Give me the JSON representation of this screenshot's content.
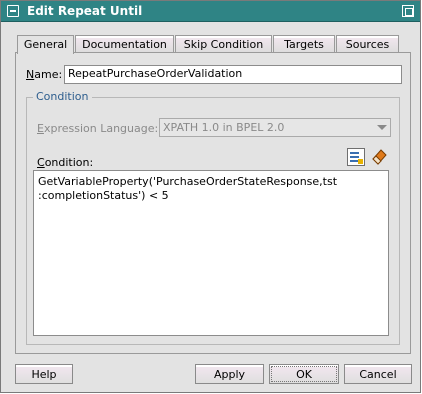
{
  "window": {
    "title": "Edit Repeat Until"
  },
  "tabs": [
    {
      "label": "General",
      "active": true
    },
    {
      "label": "Documentation",
      "active": false
    },
    {
      "label": "Skip Condition",
      "active": false
    },
    {
      "label": "Targets",
      "active": false
    },
    {
      "label": "Sources",
      "active": false
    }
  ],
  "general": {
    "name_label": "Name:",
    "name_value": "RepeatPurchaseOrderValidation",
    "condition_group_title": "Condition",
    "expression_language_label": "Expression Language:",
    "expression_language_value": "XPATH 1.0 in BPEL 2.0",
    "condition_label": "Condition:",
    "condition_value": "GetVariableProperty('PurchaseOrderStateResponse,tst\n:completionStatus') < 5"
  },
  "buttons": {
    "help": "Help",
    "apply": "Apply",
    "ok": "OK",
    "cancel": "Cancel"
  },
  "colors": {
    "titlebar": "#2f8485",
    "group_title": "#2e5e8e"
  },
  "icons": {
    "window": "window-menu-icon",
    "maximize": "maximize-icon",
    "xpath_builder": "xpath-expression-builder-icon",
    "clear": "eraser-icon"
  }
}
